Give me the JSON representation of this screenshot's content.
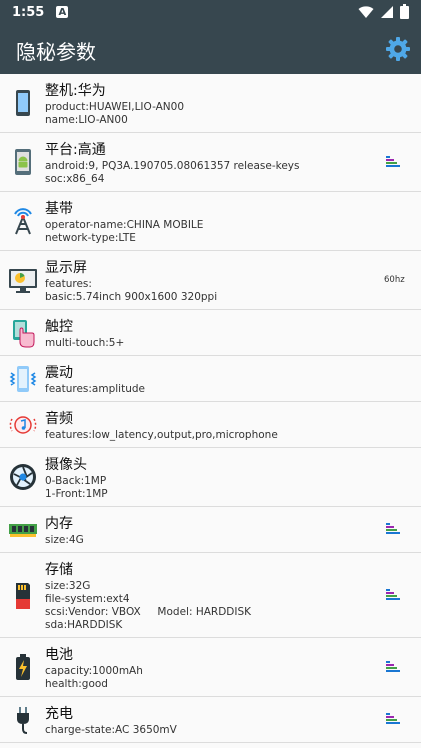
{
  "status_bar": {
    "time": "1:55",
    "notif_letter": "A"
  },
  "app_bar": {
    "title": "隐秘参数"
  },
  "rows": [
    {
      "title": "整机:华为",
      "lines": [
        "product:HUAWEI,LIO-AN00",
        "name:LIO-AN00"
      ],
      "icon": "phone-icon"
    },
    {
      "title": "平台:高通",
      "lines": [
        "android:9, PQ3A.190705.08061357 release-keys",
        "soc:x86_64"
      ],
      "icon": "android-icon"
    },
    {
      "title": "基带",
      "lines": [
        "operator-name:CHINA MOBILE",
        "network-type:LTE"
      ],
      "icon": "antenna-icon"
    },
    {
      "title": "显示屏",
      "lines": [
        "features:",
        "basic:5.74inch 900x1600 320ppi"
      ],
      "extra": "60hz",
      "icon": "monitor-icon"
    },
    {
      "title": "触控",
      "lines": [
        "multi-touch:5+"
      ],
      "icon": "touch-hand-icon"
    },
    {
      "title": "震动",
      "lines": [
        "features:amplitude"
      ],
      "icon": "vibration-icon"
    },
    {
      "title": "音频",
      "lines": [
        "features:low_latency,output,pro,microphone"
      ],
      "icon": "audio-icon"
    },
    {
      "title": "摄像头",
      "lines": [
        "0-Back:1MP",
        "1-Front:1MP"
      ],
      "icon": "camera-aperture-icon"
    },
    {
      "title": "内存",
      "lines": [
        "size:4G"
      ],
      "icon": "memory-chip-icon"
    },
    {
      "title": "存储",
      "lines": [
        "size:32G",
        "file-system:ext4",
        "scsi:Vendor: VBOX     Model: HARDDISK",
        "sda:HARDDISK"
      ],
      "icon": "sd-card-icon"
    },
    {
      "title": "电池",
      "lines": [
        "capacity:1000mAh",
        "health:good"
      ],
      "icon": "battery-icon"
    },
    {
      "title": "充电",
      "lines": [
        "charge-state:AC 3650mV"
      ],
      "icon": "plug-icon"
    }
  ]
}
